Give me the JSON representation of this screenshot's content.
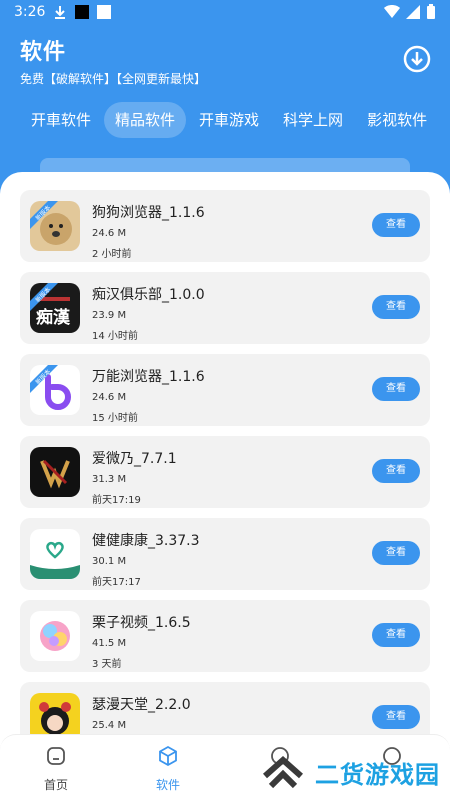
{
  "status": {
    "time": "3:26"
  },
  "header": {
    "title": "软件",
    "subtitle": "免费【破解软件】【全网更新最快】"
  },
  "tabs": [
    "开車软件",
    "精品软件",
    "开車游戏",
    "科学上网",
    "影视软件"
  ],
  "apps": [
    {
      "name": "狗狗浏览器_1.1.6",
      "size": "24.6 M",
      "time": "2 小时前",
      "button": "查看",
      "badge": "新版本"
    },
    {
      "name": "痴汉俱乐部_1.0.0",
      "size": "23.9 M",
      "time": "14 小时前",
      "button": "查看",
      "badge": "新版本",
      "icon_text": "痴漢"
    },
    {
      "name": "万能浏览器_1.1.6",
      "size": "24.6 M",
      "time": "15 小时前",
      "button": "查看",
      "badge": "新版本"
    },
    {
      "name": "爱微乃_7.7.1",
      "size": "31.3 M",
      "time": "前天17:19",
      "button": "查看"
    },
    {
      "name": "健健康康_3.37.3",
      "size": "30.1 M",
      "time": "前天17:17",
      "button": "查看"
    },
    {
      "name": "栗子视频_1.6.5",
      "size": "41.5 M",
      "time": "3 天前",
      "button": "查看"
    },
    {
      "name": "瑟漫天堂_2.2.0",
      "size": "25.4 M",
      "time": "",
      "button": "查看"
    }
  ],
  "nav": [
    {
      "label": "首页",
      "icon": "home-icon"
    },
    {
      "label": "软件",
      "icon": "cube-icon",
      "active": true
    },
    {
      "label": "",
      "icon": "hidden-icon"
    },
    {
      "label": "",
      "icon": "hidden-icon"
    }
  ],
  "watermark": {
    "text": "二货游戏园"
  },
  "colors": {
    "primary": "#3b95ee",
    "card": "#f2f2f2"
  }
}
